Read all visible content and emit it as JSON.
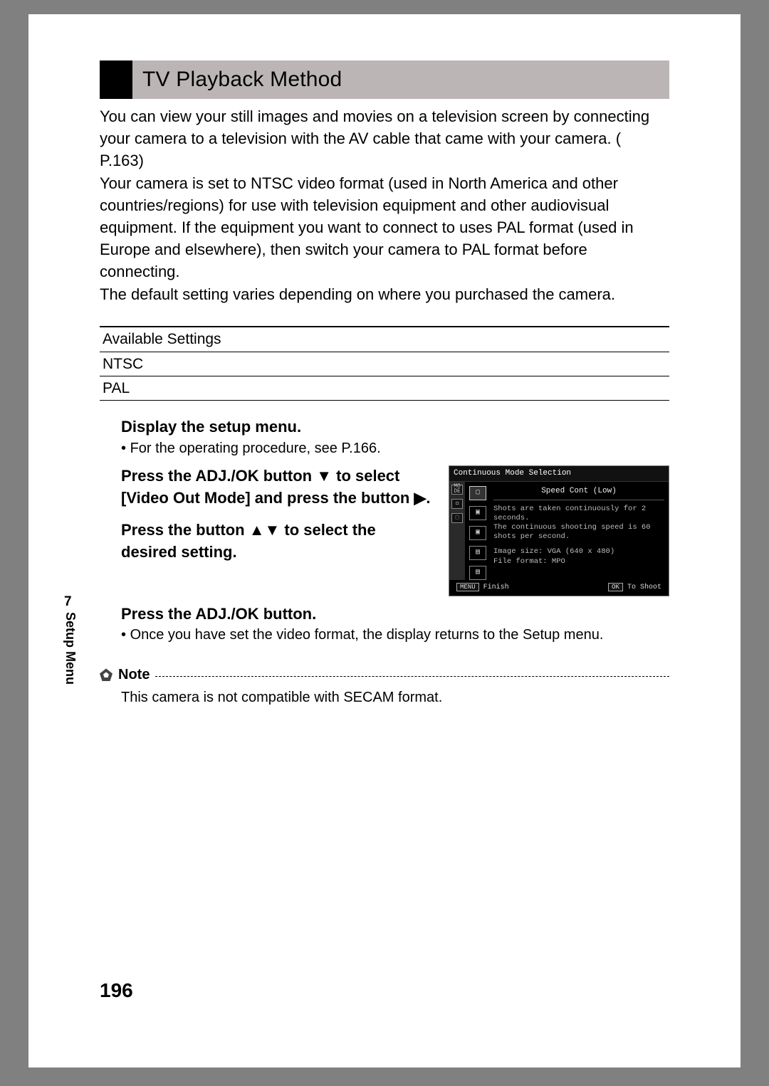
{
  "header": {
    "title": "TV Playback Method"
  },
  "intro": {
    "p1a": "You can view your still images and movies on a television screen by connecting your camera to a television with the AV cable that came with your camera. (",
    "ref1": "P.163",
    "p1b": ")",
    "p2": "Your camera is set to NTSC video format (used in North America and other countries/regions) for use with television equipment and other audiovisual equipment. If the equipment you want to connect to uses PAL format (used in Europe and elsewhere), then switch your camera to PAL format before connecting.",
    "p3": "The default setting varies depending on where you purchased the camera."
  },
  "table": {
    "header": "Available Settings",
    "rows": [
      "NTSC",
      "PAL"
    ]
  },
  "steps": {
    "s1": {
      "title": "Display the setup menu.",
      "bullet": "For the operating procedure, see P.166."
    },
    "s2": {
      "title_a": "Press the ADJ./OK button ",
      "title_b": " to select [Video Out Mode] and press the button ",
      "title_c": "."
    },
    "s3": {
      "title_a": "Press the button ",
      "title_b": " to select the desired setting."
    },
    "s4": {
      "title": "Press the ADJ./OK button.",
      "bullet": "Once you have set the video format, the display returns to the Setup menu."
    }
  },
  "screenshot": {
    "title": "Continuous Mode Selection",
    "selected_label": "Speed Cont (Low)",
    "line1": "Shots are taken continuously for 2 seconds.",
    "line2": "The continuous shooting speed is 60 shots per second.",
    "line3": "Image size: VGA (640 x 480)",
    "line4": "File format: MPO",
    "footer_left_btn": "MENU",
    "footer_left_text": "Finish",
    "footer_right_btn": "OK",
    "footer_right_text": "To Shoot",
    "tab1": "MO\nDE",
    "tab2": "□",
    "tab3": "⬚"
  },
  "note": {
    "label": "Note",
    "text": "This camera is not compatible with SECAM format."
  },
  "sidebar": {
    "chapter_num": "7",
    "chapter_title": "Setup Menu"
  },
  "page_number": "196"
}
